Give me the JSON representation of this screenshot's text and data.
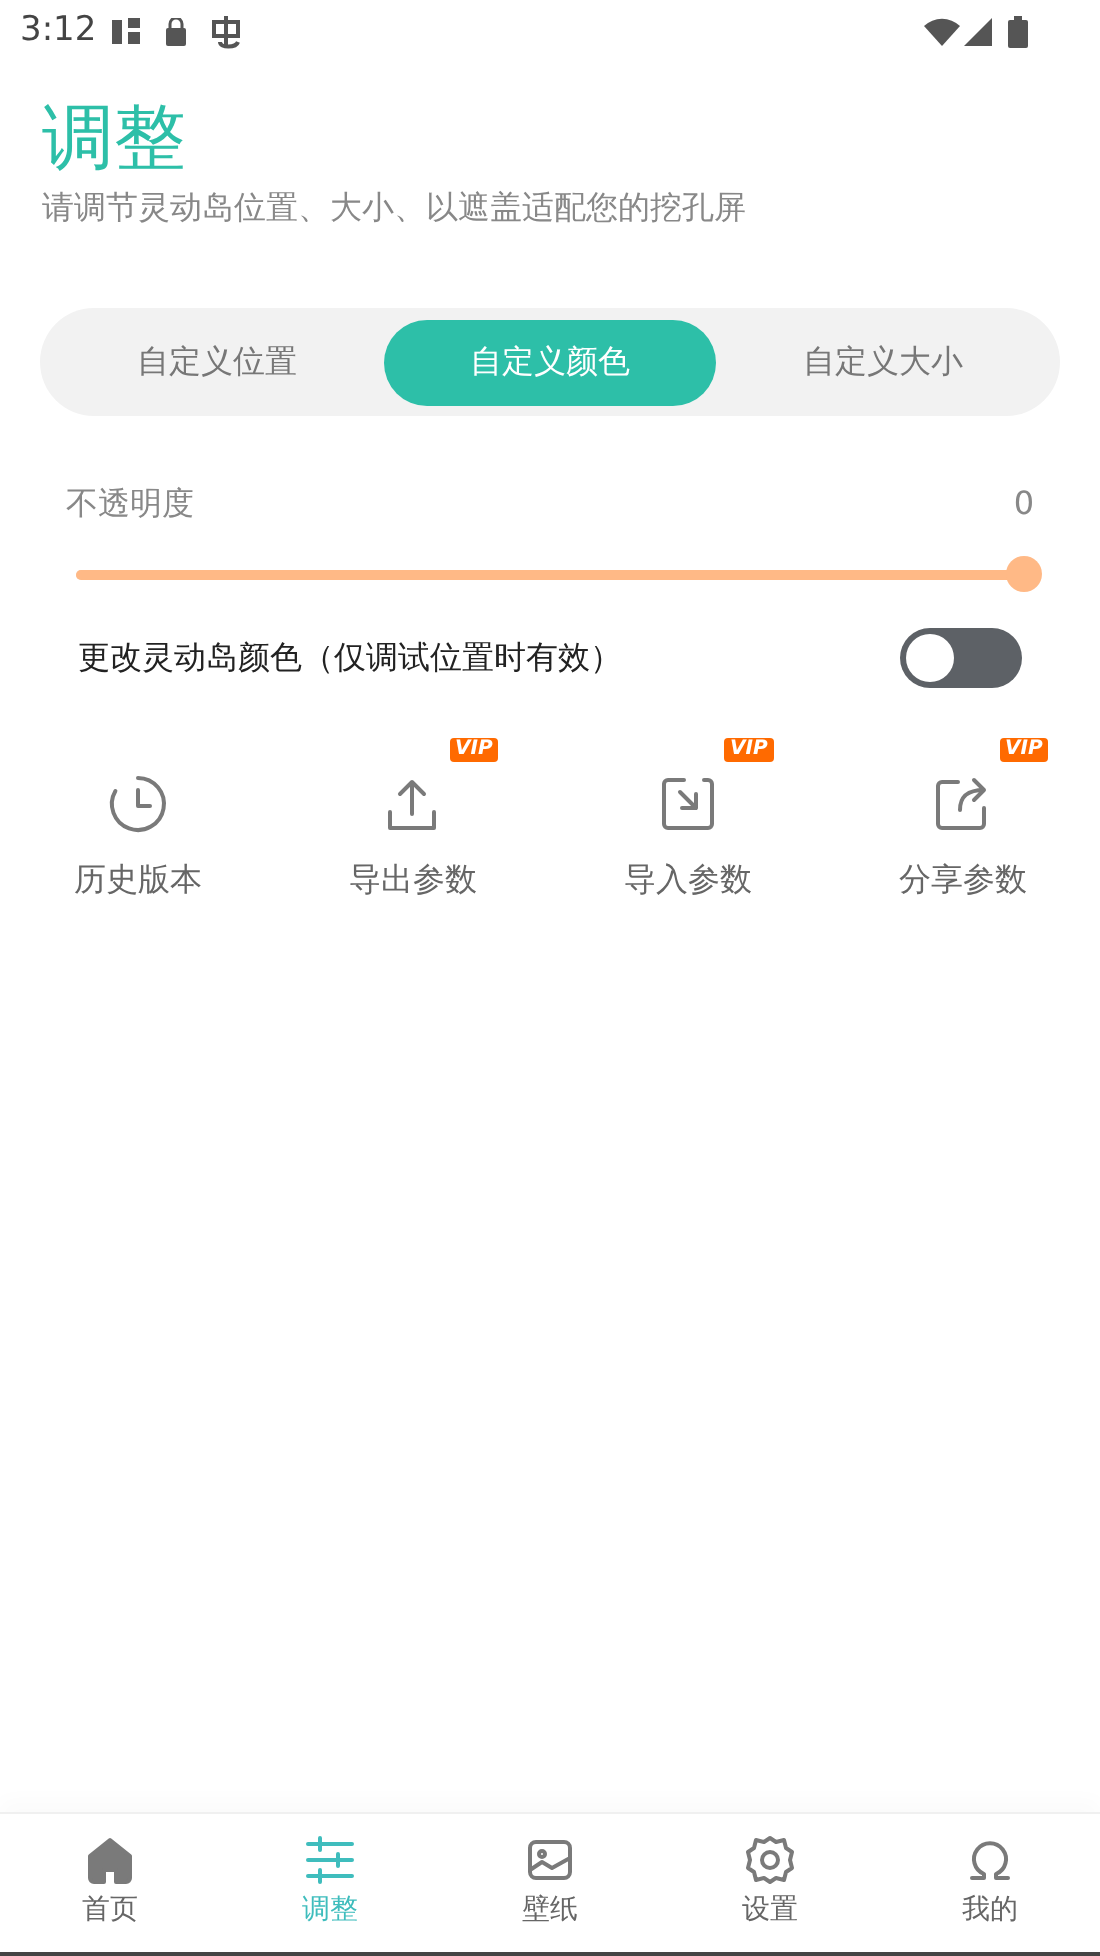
{
  "status_bar": {
    "time": "3:12"
  },
  "header": {
    "title": "调整",
    "subtitle": "请调节灵动岛位置、大小、以遮盖适配您的挖孔屏"
  },
  "tabs": [
    {
      "label": "自定义位置",
      "selected": false
    },
    {
      "label": "自定义颜色",
      "selected": true
    },
    {
      "label": "自定义大小",
      "selected": false
    }
  ],
  "opacity": {
    "label": "不透明度",
    "reading": "0",
    "level": 1
  },
  "color_toggle": {
    "label": "更改灵动岛颜色（仅调试位置时有效）",
    "on": false
  },
  "actions": [
    {
      "kind": "history",
      "label": "历史版本"
    },
    {
      "kind": "export",
      "label": "导出参数",
      "badge": "VIP"
    },
    {
      "kind": "import",
      "label": "导入参数",
      "badge": "VIP"
    },
    {
      "kind": "share",
      "label": "分享参数",
      "badge": "VIP"
    }
  ],
  "bottom_nav": [
    {
      "kind": "home",
      "label": "首页",
      "selected": false
    },
    {
      "kind": "adjust",
      "label": "调整",
      "selected": true
    },
    {
      "kind": "wallpaper",
      "label": "壁纸",
      "selected": false
    },
    {
      "kind": "settings",
      "label": "设置",
      "selected": false
    },
    {
      "kind": "profile",
      "label": "我的",
      "selected": false
    }
  ]
}
